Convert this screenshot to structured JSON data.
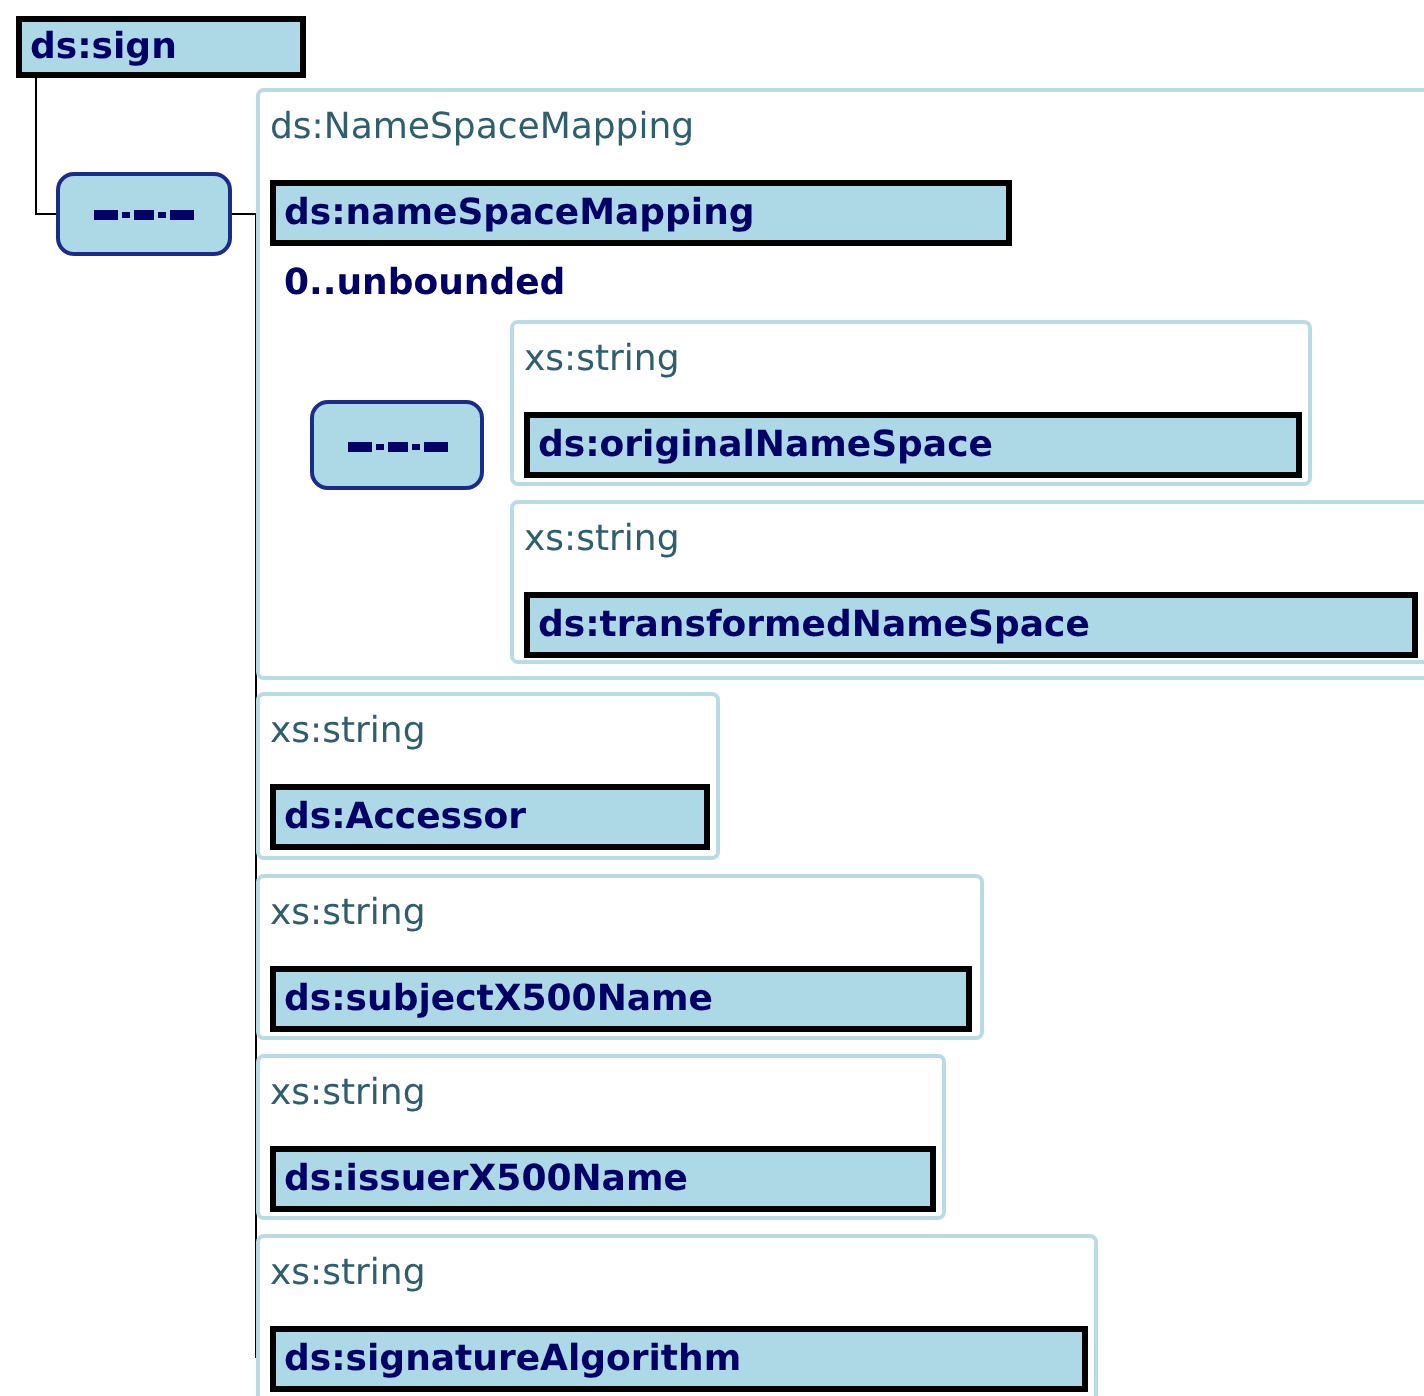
{
  "root": {
    "name": "ds:sign",
    "sequence": {
      "children": [
        {
          "type": "ds:NameSpaceMapping",
          "name": "ds:nameSpaceMapping",
          "occurs": "0..unbounded",
          "sequence": {
            "children": [
              {
                "type": "xs:string",
                "name": "ds:originalNameSpace"
              },
              {
                "type": "xs:string",
                "name": "ds:transformedNameSpace"
              }
            ]
          }
        },
        {
          "type": "xs:string",
          "name": "ds:Accessor"
        },
        {
          "type": "xs:string",
          "name": "ds:subjectX500Name"
        },
        {
          "type": "xs:string",
          "name": "ds:issuerX500Name"
        },
        {
          "type": "xs:string",
          "name": "ds:signatureAlgorithm"
        }
      ]
    }
  }
}
